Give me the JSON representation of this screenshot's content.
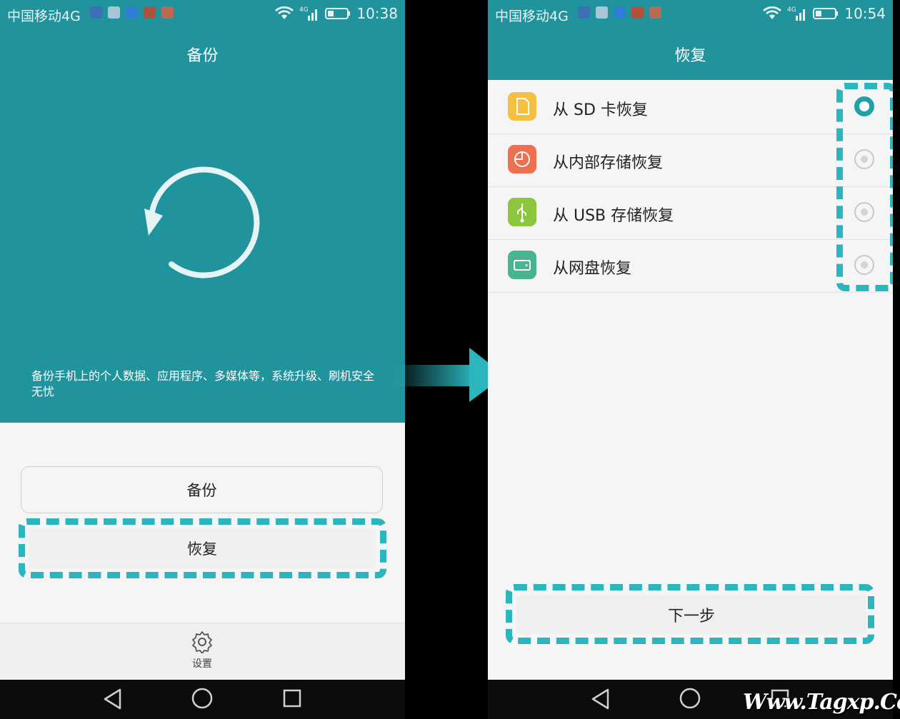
{
  "left": {
    "status": {
      "carrier": "中国移动4G",
      "time": "10:38",
      "network": "4G"
    },
    "title": "备份",
    "description": "备份手机上的个人数据、应用程序、多媒体等，系统升级、刷机安全无忧",
    "backup_button": "备份",
    "restore_button": "恢复",
    "settings_label": "设置"
  },
  "right": {
    "status": {
      "carrier": "中国移动4G",
      "time": "10:54",
      "network": "4G"
    },
    "title": "恢复",
    "options": [
      {
        "label": "从 SD 卡恢复",
        "icon": "sd-card-icon",
        "color": "#f5c041",
        "selected": true
      },
      {
        "label": "从内部存储恢复",
        "icon": "internal-storage-icon",
        "color": "#ee7050",
        "selected": false
      },
      {
        "label": "从 USB 存储恢复",
        "icon": "usb-icon",
        "color": "#8cc63f",
        "selected": false
      },
      {
        "label": "从网盘恢复",
        "icon": "cloud-drive-icon",
        "color": "#49b48f",
        "selected": false
      }
    ],
    "next_button": "下一步"
  },
  "watermark": "Www.Tagxp.Com",
  "colors": {
    "teal": "#21939c",
    "highlight": "#2bb5bd"
  }
}
